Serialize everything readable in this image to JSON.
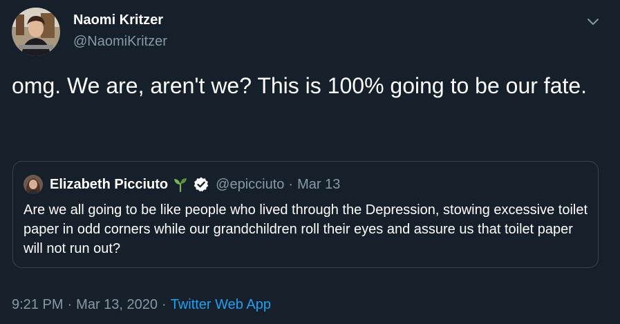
{
  "author": {
    "name": "Naomi Kritzer",
    "handle": "@NaomiKritzer"
  },
  "tweet": {
    "text": "omg. We are, aren't we? This is 100% going to be our fate."
  },
  "quoted_tweet": {
    "name": "Elizabeth Picciuto",
    "name_emoji": "sprout-icon",
    "verified": true,
    "handle": "@epicciuto",
    "separator": "·",
    "date": "Mar 13",
    "text": "Are we all going to be like people who lived through the Depression, stowing excessive toilet paper in odd corners while our grandchildren roll their eyes and assure us that toilet paper will not run out?"
  },
  "meta": {
    "time": "9:21 PM",
    "separator_1": "·",
    "date": "Mar 13, 2020",
    "separator_2": "·",
    "source": "Twitter Web App"
  },
  "colors": {
    "background": "#15202b",
    "text_primary": "#ffffff",
    "text_secondary": "#8899a6",
    "link": "#1da1f2",
    "border": "#38444d"
  }
}
